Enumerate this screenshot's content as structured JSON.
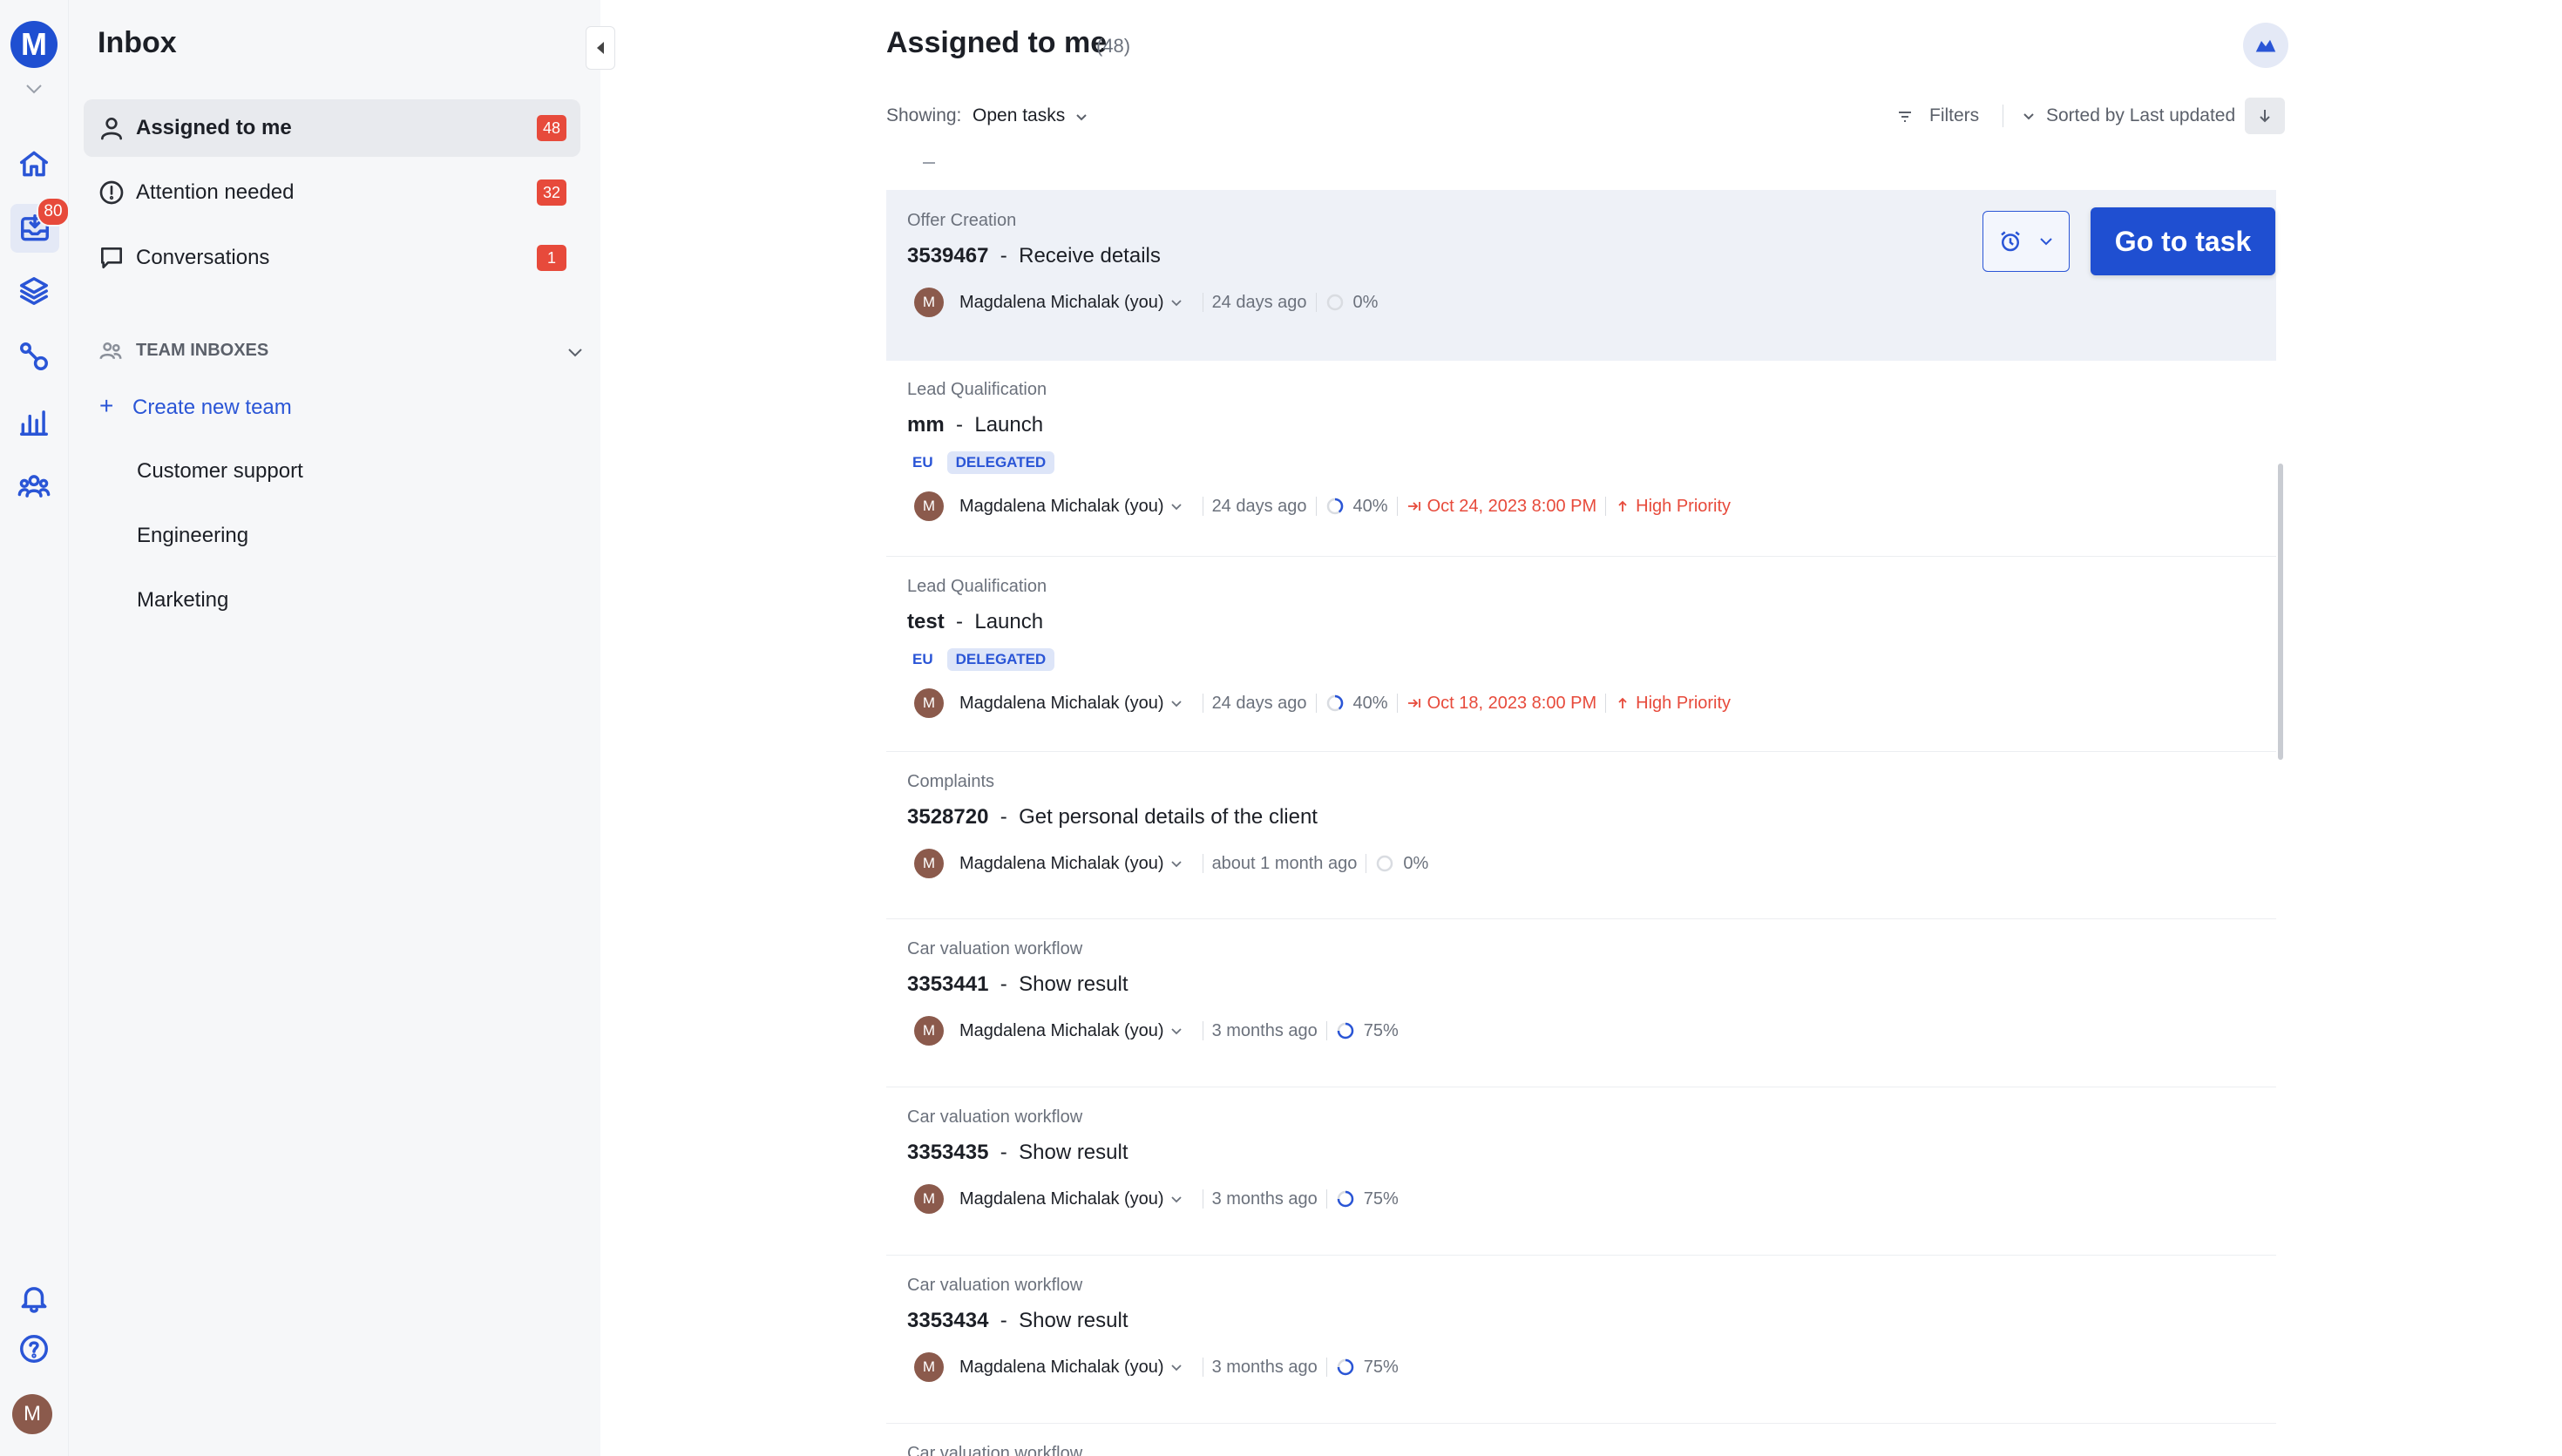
{
  "app": {
    "logo_letter": "M",
    "rail_badge": "80",
    "user_initial": "M",
    "accent": "#1f4fd1",
    "danger": "#e74a3b"
  },
  "sidebar": {
    "title": "Inbox",
    "items": [
      {
        "label": "Assigned to me",
        "count": "48",
        "icon": "person-icon"
      },
      {
        "label": "Attention needed",
        "count": "32",
        "icon": "alert-circle-icon"
      },
      {
        "label": "Conversations",
        "count": "1",
        "icon": "chat-bubble-icon"
      }
    ],
    "team_header": "TEAM INBOXES",
    "create_team": "Create new team",
    "teams": [
      "Customer support",
      "Engineering",
      "Marketing"
    ]
  },
  "main": {
    "title": "Assigned to me",
    "count": "(48)",
    "showing_label": "Showing:",
    "showing_value": "Open tasks",
    "filters_label": "Filters",
    "sort_label": "Sorted by Last updated",
    "go_to_task": "Go to task"
  },
  "tasks": [
    {
      "workflow": "Offer Creation",
      "id": "3539467",
      "name": "Receive details",
      "tags": [],
      "assignee": "Magdalena Michalak (you)",
      "avatar": "M",
      "updated": "24 days ago",
      "progress": "0%",
      "due": "",
      "priority": ""
    },
    {
      "workflow": "Lead Qualification",
      "id": "mm",
      "name": "Launch",
      "tags": [
        "EU",
        "DELEGATED"
      ],
      "assignee": "Magdalena Michalak (you)",
      "avatar": "M",
      "updated": "24 days ago",
      "progress": "40%",
      "due": "Oct 24, 2023 8:00 PM",
      "priority": "High Priority"
    },
    {
      "workflow": "Lead Qualification",
      "id": "test",
      "name": "Launch",
      "tags": [
        "EU",
        "DELEGATED"
      ],
      "assignee": "Magdalena Michalak (you)",
      "avatar": "M",
      "updated": "24 days ago",
      "progress": "40%",
      "due": "Oct 18, 2023 8:00 PM",
      "priority": "High Priority"
    },
    {
      "workflow": "Complaints",
      "id": "3528720",
      "name": "Get personal details of the client",
      "tags": [],
      "assignee": "Magdalena Michalak (you)",
      "avatar": "M",
      "updated": "about 1 month ago",
      "progress": "0%",
      "due": "",
      "priority": ""
    },
    {
      "workflow": "Car valuation workflow",
      "id": "3353441",
      "name": "Show result",
      "tags": [],
      "assignee": "Magdalena Michalak (you)",
      "avatar": "M",
      "updated": "3 months ago",
      "progress": "75%",
      "due": "",
      "priority": ""
    },
    {
      "workflow": "Car valuation workflow",
      "id": "3353435",
      "name": "Show result",
      "tags": [],
      "assignee": "Magdalena Michalak (you)",
      "avatar": "M",
      "updated": "3 months ago",
      "progress": "75%",
      "due": "",
      "priority": ""
    },
    {
      "workflow": "Car valuation workflow",
      "id": "3353434",
      "name": "Show result",
      "tags": [],
      "assignee": "Magdalena Michalak (you)",
      "avatar": "M",
      "updated": "3 months ago",
      "progress": "75%",
      "due": "",
      "priority": ""
    },
    {
      "workflow": "Car valuation workflow",
      "id": "",
      "name": "",
      "tags": [],
      "assignee": "",
      "avatar": "",
      "updated": "",
      "progress": "",
      "due": "",
      "priority": ""
    }
  ]
}
